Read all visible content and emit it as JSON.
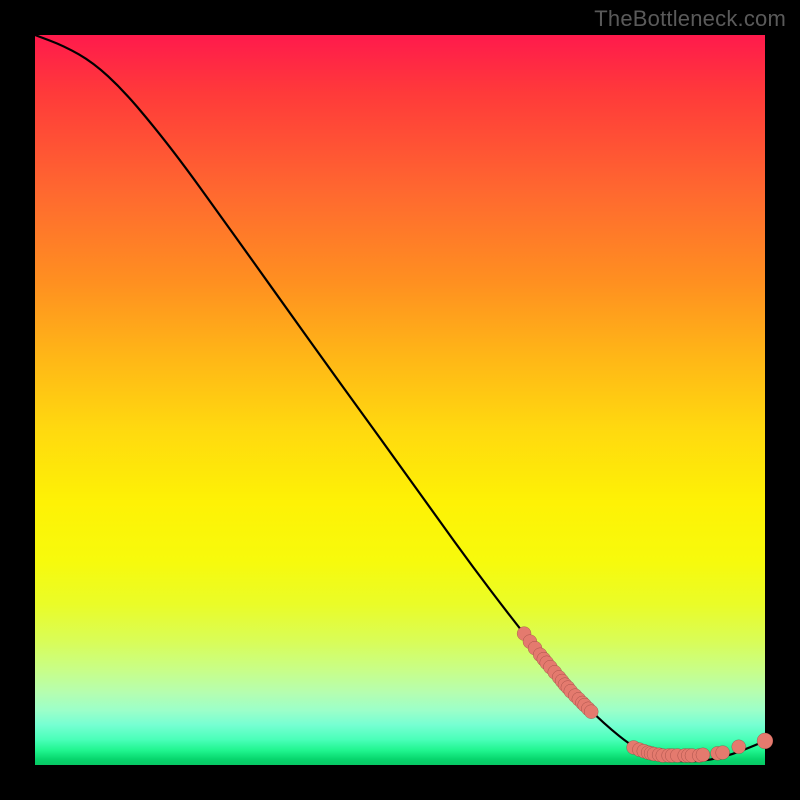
{
  "watermark": "TheBottleneck.com",
  "colors": {
    "background": "#000000",
    "curve": "#000000",
    "dot_fill": "#e47a6e"
  },
  "chart_data": {
    "type": "line",
    "title": "",
    "xlabel": "",
    "ylabel": "",
    "xlim": [
      0,
      100
    ],
    "ylim": [
      0,
      100
    ],
    "grid": false,
    "curve": [
      {
        "x": 0,
        "y": 100
      },
      {
        "x": 4,
        "y": 98.5
      },
      {
        "x": 8,
        "y": 96.2
      },
      {
        "x": 12,
        "y": 92.5
      },
      {
        "x": 16,
        "y": 87.8
      },
      {
        "x": 20,
        "y": 82.7
      },
      {
        "x": 25,
        "y": 75.8
      },
      {
        "x": 30,
        "y": 68.8
      },
      {
        "x": 35,
        "y": 61.8
      },
      {
        "x": 40,
        "y": 54.8
      },
      {
        "x": 45,
        "y": 47.9
      },
      {
        "x": 50,
        "y": 41.0
      },
      {
        "x": 55,
        "y": 34.0
      },
      {
        "x": 60,
        "y": 27.1
      },
      {
        "x": 65,
        "y": 20.5
      },
      {
        "x": 70,
        "y": 14.2
      },
      {
        "x": 74,
        "y": 9.6
      },
      {
        "x": 78,
        "y": 5.6
      },
      {
        "x": 82,
        "y": 2.4
      },
      {
        "x": 85,
        "y": 1.0
      },
      {
        "x": 88,
        "y": 0.5
      },
      {
        "x": 91,
        "y": 0.5
      },
      {
        "x": 94,
        "y": 1.0
      },
      {
        "x": 97,
        "y": 2.0
      },
      {
        "x": 100,
        "y": 3.3
      }
    ],
    "series": [
      {
        "name": "highlighted-points",
        "type": "scatter",
        "points": [
          {
            "x": 67.0,
            "y": 18.0
          },
          {
            "x": 67.8,
            "y": 16.9
          },
          {
            "x": 68.5,
            "y": 16.0
          },
          {
            "x": 69.2,
            "y": 15.1
          },
          {
            "x": 69.7,
            "y": 14.5
          },
          {
            "x": 70.1,
            "y": 14.0
          },
          {
            "x": 70.6,
            "y": 13.4
          },
          {
            "x": 71.2,
            "y": 12.7
          },
          {
            "x": 71.8,
            "y": 12.0
          },
          {
            "x": 72.2,
            "y": 11.5
          },
          {
            "x": 72.6,
            "y": 11.0
          },
          {
            "x": 73.0,
            "y": 10.6
          },
          {
            "x": 73.4,
            "y": 10.1
          },
          {
            "x": 74.0,
            "y": 9.5
          },
          {
            "x": 74.5,
            "y": 9.0
          },
          {
            "x": 75.0,
            "y": 8.5
          },
          {
            "x": 75.3,
            "y": 8.2
          },
          {
            "x": 75.8,
            "y": 7.7
          },
          {
            "x": 76.2,
            "y": 7.3
          },
          {
            "x": 82.0,
            "y": 2.4
          },
          {
            "x": 82.8,
            "y": 2.1
          },
          {
            "x": 83.4,
            "y": 1.9
          },
          {
            "x": 84.0,
            "y": 1.7
          },
          {
            "x": 84.4,
            "y": 1.6
          },
          {
            "x": 84.8,
            "y": 1.5
          },
          {
            "x": 85.5,
            "y": 1.4
          },
          {
            "x": 86.0,
            "y": 1.3
          },
          {
            "x": 86.8,
            "y": 1.3
          },
          {
            "x": 87.3,
            "y": 1.3
          },
          {
            "x": 88.0,
            "y": 1.3
          },
          {
            "x": 89.0,
            "y": 1.3
          },
          {
            "x": 89.5,
            "y": 1.3
          },
          {
            "x": 90.0,
            "y": 1.3
          },
          {
            "x": 91.0,
            "y": 1.3
          },
          {
            "x": 91.5,
            "y": 1.4
          },
          {
            "x": 93.5,
            "y": 1.6
          },
          {
            "x": 94.2,
            "y": 1.7
          },
          {
            "x": 96.4,
            "y": 2.5
          },
          {
            "x": 100.0,
            "y": 3.3
          }
        ]
      }
    ]
  }
}
